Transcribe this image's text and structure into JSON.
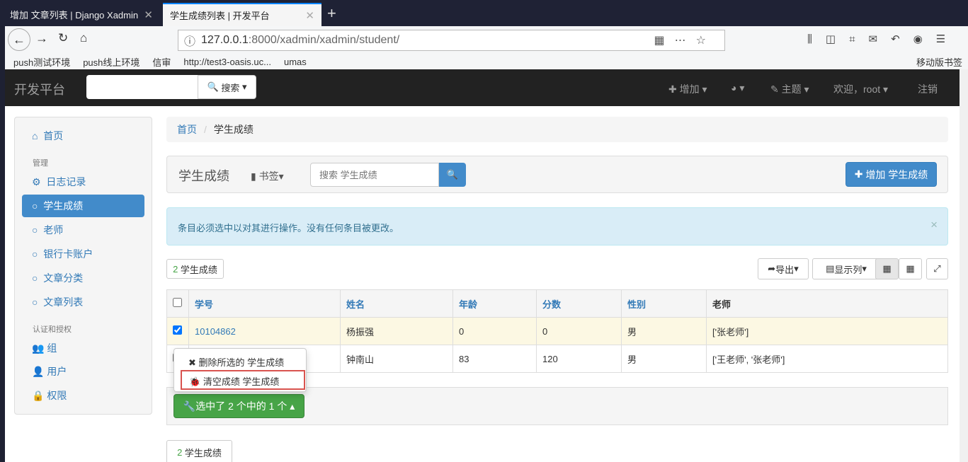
{
  "browser": {
    "tabs": [
      {
        "title": "增加 文章列表 | Django Xadmin"
      },
      {
        "title": "学生成绩列表 | 开发平台"
      }
    ],
    "url_host": "127.0.0.1",
    "url_path": ":8000/xadmin/xadmin/student/",
    "bookmarks": [
      "push测试环境",
      "push线上环境",
      "信审",
      "http://test3-oasis.uc...",
      "umas"
    ],
    "mobile_bookmarks": "移动版书签"
  },
  "navbar": {
    "brand": "开发平台",
    "search_label": "搜索",
    "add": "增加",
    "theme": "主题",
    "welcome": "欢迎，root",
    "logout": "注销"
  },
  "sidebar": {
    "home": "首页",
    "section_manage": "管理",
    "items": [
      "日志记录",
      "学生成绩",
      "老师",
      "银行卡账户",
      "文章分类",
      "文章列表"
    ],
    "section_auth": "认证和授权",
    "auth_items": [
      "组",
      "用户",
      "权限"
    ]
  },
  "breadcrumb": [
    "首页",
    "学生成绩"
  ],
  "header": {
    "title": "学生成绩",
    "bookmark": "书签",
    "search_placeholder": "搜索 学生成绩",
    "add_button": "增加 学生成绩"
  },
  "alert": "条目必须选中以对其进行操作。没有任何条目被更改。",
  "count": {
    "num": "2",
    "label": "学生成绩"
  },
  "tools": {
    "export": "导出",
    "columns": "显示列"
  },
  "table": {
    "headers": [
      "学号",
      "姓名",
      "年龄",
      "分数",
      "性别",
      "老师"
    ],
    "rows": [
      {
        "checked": true,
        "cells": [
          "10104862",
          "杨振强",
          "0",
          "0",
          "男",
          "['张老师']"
        ]
      },
      {
        "checked": false,
        "cells": [
          "",
          "钟南山",
          "83",
          "120",
          "男",
          "['王老师', '张老师']"
        ]
      }
    ]
  },
  "actions": {
    "menu": [
      "删除所选的 学生成绩",
      "清空成绩 学生成绩"
    ],
    "button": "选中了 2 个中的 1 个"
  },
  "colors": {
    "primary": "#428bca",
    "success": "#47a447",
    "highlight": "#d9534f"
  }
}
